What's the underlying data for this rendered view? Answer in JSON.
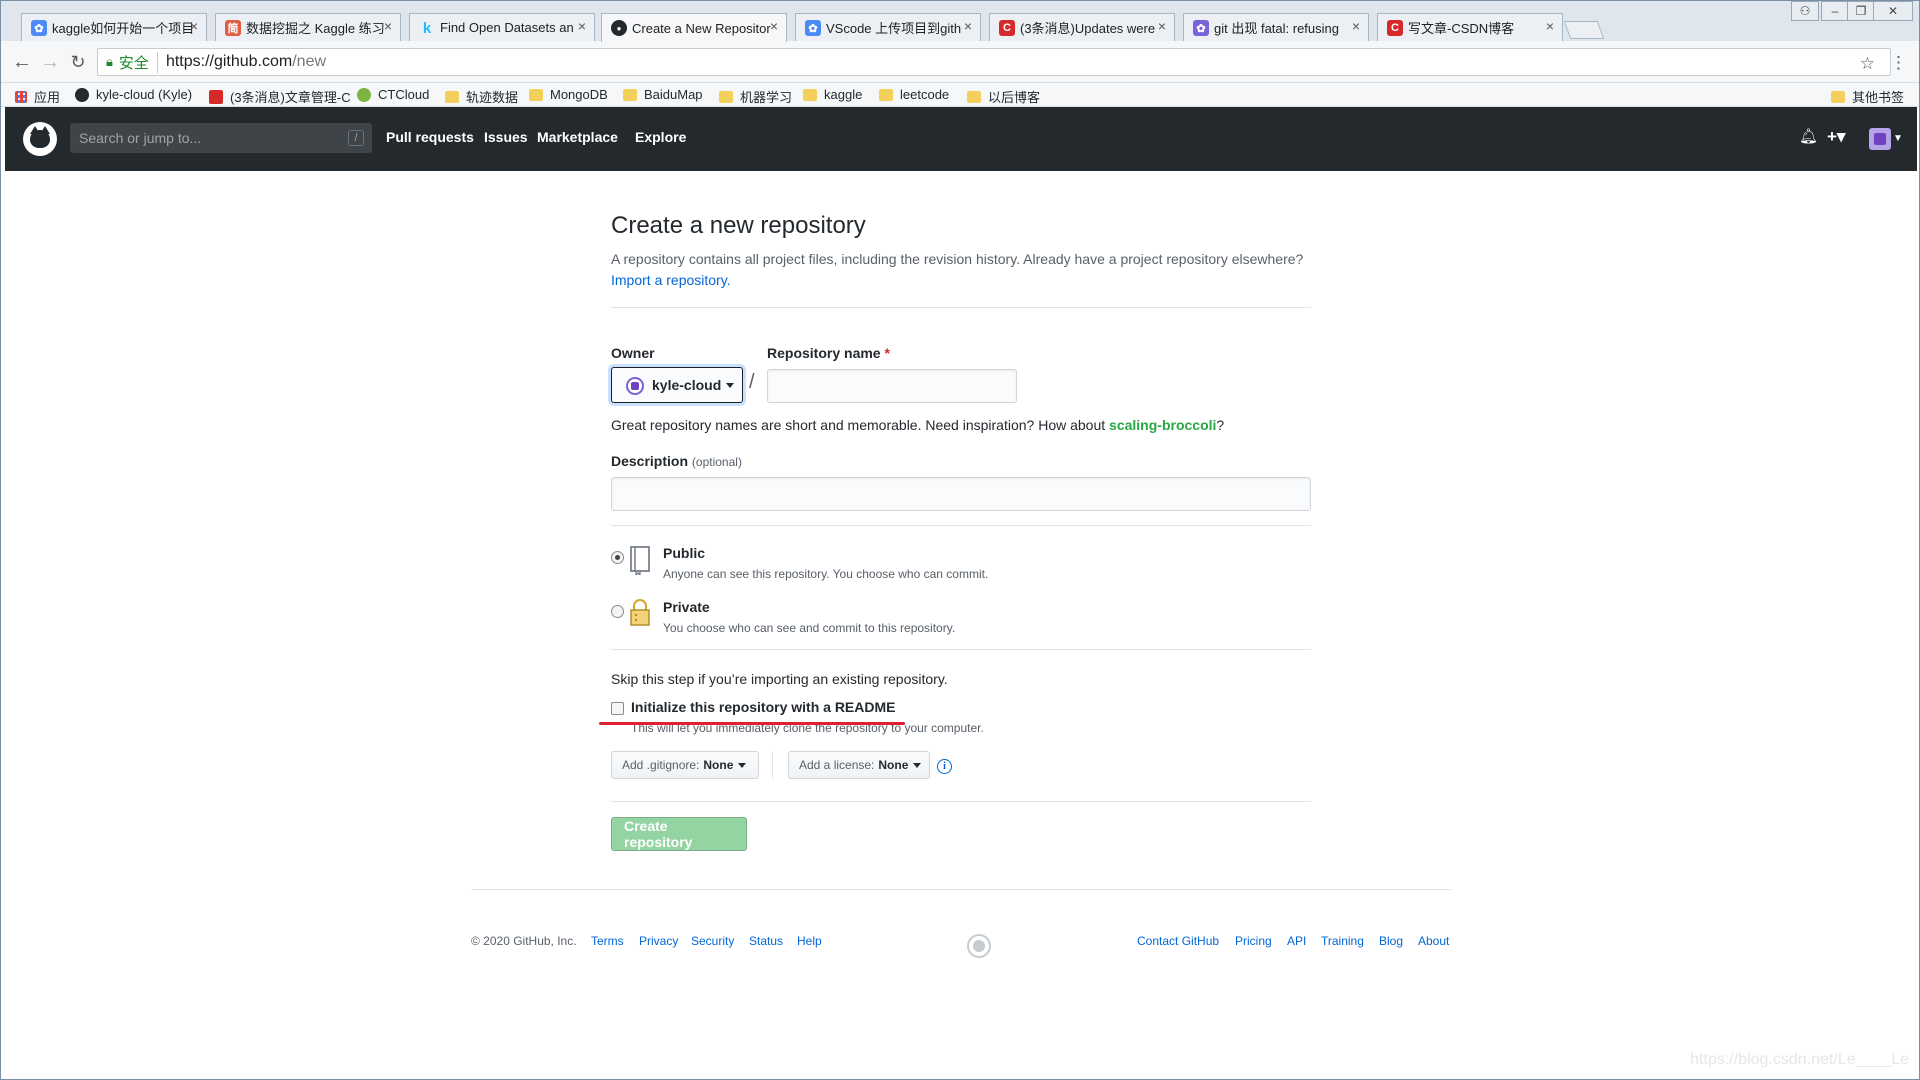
{
  "browser": {
    "tabs": [
      {
        "label": "kaggle如何开始一个项目",
        "fav_color": "#4c8bf5",
        "fav_glyph": "✿"
      },
      {
        "label": "数据挖掘之 Kaggle 练习",
        "fav_color": "#e05d44",
        "fav_glyph": "简"
      },
      {
        "label": "Find Open Datasets an",
        "fav_color": "#20beff",
        "fav_glyph": "k"
      },
      {
        "label": "Create a New Repositor",
        "fav_color": "#24292e",
        "fav_glyph": "●"
      },
      {
        "label": "VScode 上传项目到gith",
        "fav_color": "#4c8bf5",
        "fav_glyph": "✿"
      },
      {
        "label": "(3条消息)Updates were",
        "fav_color": "#d62a2a",
        "fav_glyph": "C"
      },
      {
        "label": "git 出现 fatal: refusing",
        "fav_color": "#7a63d6",
        "fav_glyph": "✿"
      },
      {
        "label": "写文章-CSDN博客",
        "fav_color": "#d62a2a",
        "fav_glyph": "C"
      }
    ],
    "secure_label": "安全",
    "url_host": "https://github.com",
    "url_path": "/new",
    "bookmarks": [
      {
        "label": "应用"
      },
      {
        "label": "kyle-cloud (Kyle)"
      },
      {
        "label": "(3条消息)文章管理-C"
      },
      {
        "label": "CTCloud"
      },
      {
        "label": "轨迹数据"
      },
      {
        "label": "MongoDB"
      },
      {
        "label": "BaiduMap"
      },
      {
        "label": "机器学习"
      },
      {
        "label": "kaggle"
      },
      {
        "label": "leetcode"
      },
      {
        "label": "以后博客"
      }
    ],
    "other_bookmarks": "其他书签"
  },
  "header": {
    "search_placeholder": "Search or jump to...",
    "search_key": "/",
    "nav": [
      "Pull requests",
      "Issues",
      "Marketplace",
      "Explore"
    ],
    "plus": "+▾"
  },
  "page": {
    "title": "Create a new repository",
    "subhead": "A repository contains all project files, including the revision history. Already have a project repository elsewhere?",
    "import_link": "Import a repository.",
    "owner_label": "Owner",
    "owner_value": "kyle-cloud",
    "repo_label": "Repository name",
    "required_mark": "*",
    "repo_value": "",
    "hint_prefix": "Great repository names are short and memorable. Need inspiration? How about ",
    "hint_suggestion": "scaling-broccoli",
    "hint_suffix": "?",
    "description_label": "Description",
    "description_optional": "(optional)",
    "description_value": "",
    "public_title": "Public",
    "public_desc": "Anyone can see this repository. You choose who can commit.",
    "private_title": "Private",
    "private_desc": "You choose who can see and commit to this repository.",
    "visibility_selected": "public",
    "skip_text": "Skip this step if you’re importing an existing repository.",
    "init_label": "Initialize this repository with a README",
    "init_desc": "This will let you immediately clone the repository to your computer.",
    "gitignore_label": "Add .gitignore:",
    "gitignore_value": "None",
    "license_label": "Add a license:",
    "license_value": "None",
    "info_glyph": "i",
    "create_button": "Create repository",
    "annotation_color": "#e0202e"
  },
  "footer": {
    "copyright": "© 2020 GitHub, Inc.",
    "left_links": [
      "Terms",
      "Privacy",
      "Security",
      "Status",
      "Help"
    ],
    "right_links": [
      "Contact GitHub",
      "Pricing",
      "API",
      "Training",
      "Blog",
      "About"
    ]
  },
  "watermark": "https://blog.csdn.net/Le____Le"
}
